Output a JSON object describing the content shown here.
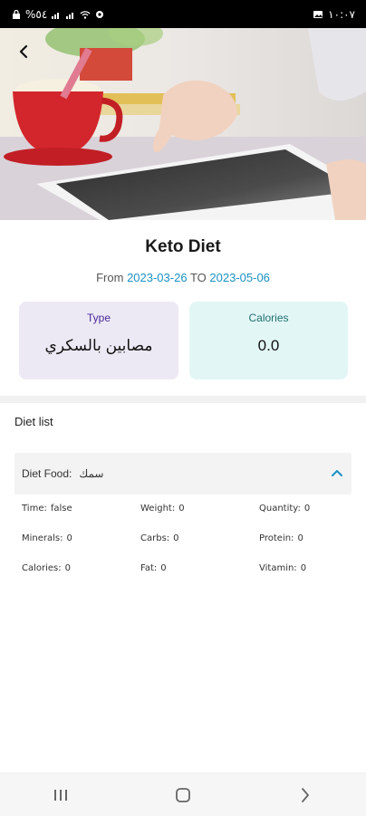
{
  "status_bar": {
    "left_text": "%٥٤",
    "time": "١٠:٠٧"
  },
  "hero": {
    "image": "woman-using-tablet-with-tea-cup"
  },
  "header": {
    "back_icon": "chevron-left-icon"
  },
  "diet": {
    "title": "Keto Diet",
    "from_label": "From",
    "from_date": "2023-03-26",
    "to_label": "TO",
    "to_date": "2023-05-06"
  },
  "cards": {
    "type_label": "Type",
    "type_value": "مصابين بالسكري",
    "calories_label": "Calories",
    "calories_value": "0.0"
  },
  "diet_list": {
    "title": "Diet list",
    "item": {
      "food_label": "Diet Food:",
      "food_value": "سمك",
      "expanded_icon": "chevron-up-icon",
      "fields": [
        {
          "label": "Time:",
          "value": "false"
        },
        {
          "label": "Weight:",
          "value": "0"
        },
        {
          "label": "Quantity:",
          "value": "0"
        },
        {
          "label": "Minerals:",
          "value": "0"
        },
        {
          "label": "Carbs:",
          "value": "0"
        },
        {
          "label": "Protein:",
          "value": "0"
        },
        {
          "label": "Calories:",
          "value": "0"
        },
        {
          "label": "Fat:",
          "value": "0"
        },
        {
          "label": "Vitamin:",
          "value": "0"
        }
      ]
    }
  },
  "colors": {
    "accent_blue": "#1a91c4",
    "type_card_bg": "#ece9f4",
    "calories_card_bg": "#e3f6f6",
    "type_label": "#4a2a9a",
    "calories_label": "#1f6f6f"
  }
}
